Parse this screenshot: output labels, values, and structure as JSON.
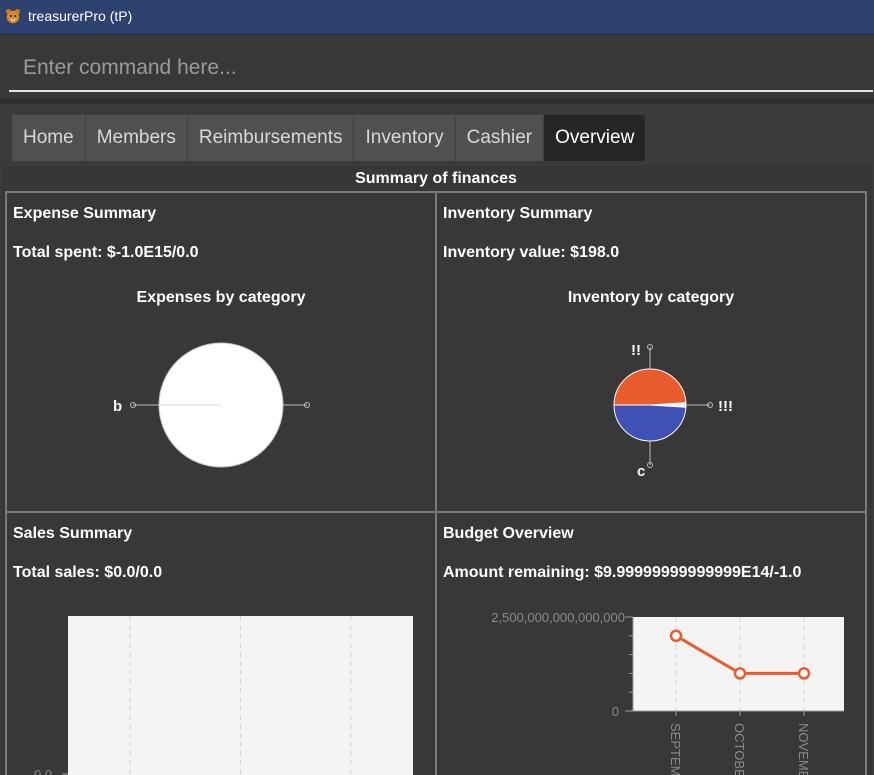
{
  "window": {
    "title": "treasurerPro (tP)",
    "icon": "bear-icon"
  },
  "command": {
    "placeholder": "Enter command here...",
    "value": ""
  },
  "tabs": [
    {
      "label": "Home",
      "active": false
    },
    {
      "label": "Members",
      "active": false
    },
    {
      "label": "Reimbursements",
      "active": false
    },
    {
      "label": "Inventory",
      "active": false
    },
    {
      "label": "Cashier",
      "active": false
    },
    {
      "label": "Overview",
      "active": true
    }
  ],
  "overview": {
    "title": "Summary of finances",
    "expense": {
      "title": "Expense Summary",
      "line": "Total spent: $-1.0E15/0.0",
      "chart_title": "Expenses by category"
    },
    "inventory": {
      "title": "Inventory Summary",
      "line": "Inventory value: $198.0",
      "chart_title": "Inventory by category"
    },
    "sales": {
      "title": "Sales Summary",
      "line": "Total sales: $0.0/0.0"
    },
    "budget": {
      "title": "Budget Overview",
      "line": "Amount remaining: $9.99999999999999E14/-1.0"
    }
  },
  "colors": {
    "accent": "#e95c2e",
    "blue": "#3f51b5",
    "titlebar": "#2d4270"
  },
  "chart_data": [
    {
      "type": "pie",
      "title": "Expenses by category",
      "labels": [
        "b",
        ""
      ],
      "values": [
        100,
        0
      ]
    },
    {
      "type": "pie",
      "title": "Inventory by category",
      "labels": [
        "!!",
        "!!!",
        "c"
      ],
      "values": [
        49,
        2,
        49
      ]
    },
    {
      "type": "line",
      "title": "",
      "categories": [],
      "ylim": [
        0,
        0
      ],
      "ytick_labels": [
        "0.0"
      ]
    },
    {
      "type": "line",
      "title": "",
      "categories": [
        "SEPTEMBER",
        "OCTOBER",
        "NOVEMBER"
      ],
      "values": [
        2000000000000000,
        1000000000000000,
        1000000000000000
      ],
      "ylim": [
        0,
        2500000000000000
      ],
      "ytick_labels": [
        "0",
        "2,500,000,000,000,000"
      ]
    }
  ]
}
